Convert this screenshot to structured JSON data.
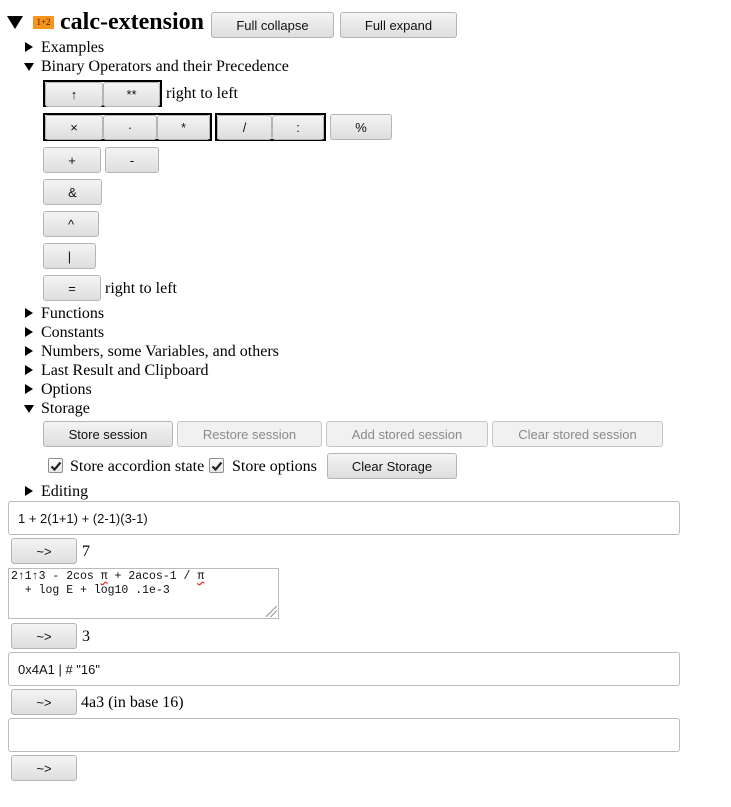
{
  "header": {
    "logo_text": "1+2",
    "title": "calc-extension",
    "full_collapse_label": "Full collapse",
    "full_expand_label": "Full expand",
    "accent_color": "#f7941d"
  },
  "sections": {
    "examples": {
      "label": "Examples",
      "expanded": false
    },
    "binary_operators": {
      "label": "Binary Operators and their Precedence",
      "expanded": true,
      "rows": {
        "power": {
          "ops": [
            "↑",
            "**"
          ],
          "note": "right to left"
        },
        "multiplicative": {
          "multiply_ops": [
            "×",
            "·",
            "*"
          ],
          "divide_ops": [
            "/",
            ":"
          ],
          "modulo": "%"
        },
        "additive": {
          "ops": [
            "+",
            "-"
          ]
        },
        "and": {
          "op": "&"
        },
        "xor": {
          "op": "^"
        },
        "or": {
          "op": "|"
        },
        "assign": {
          "op": "=",
          "note": "right to left"
        }
      }
    },
    "functions": {
      "label": "Functions",
      "expanded": false
    },
    "constants": {
      "label": "Constants",
      "expanded": false
    },
    "numbers": {
      "label": "Numbers, some Variables, and others",
      "expanded": false
    },
    "last_result": {
      "label": "Last Result and Clipboard",
      "expanded": false
    },
    "options": {
      "label": "Options",
      "expanded": false
    },
    "storage": {
      "label": "Storage",
      "expanded": true,
      "buttons": {
        "store_session": "Store session",
        "restore_session": "Restore session",
        "add_stored_session": "Add stored session",
        "clear_stored_session": "Clear stored session",
        "clear_storage": "Clear Storage"
      },
      "checkboxes": {
        "store_accordion_state": {
          "label": "Store accordion state",
          "checked": true
        },
        "store_options": {
          "label": "Store options",
          "checked": true
        }
      }
    },
    "editing": {
      "label": "Editing",
      "expanded": false
    }
  },
  "calculations": [
    {
      "input": "1 + 2(1+1) + (2-1)(3-1)",
      "button": "~>",
      "result": "7"
    },
    {
      "input_line1": "2↑1↑3 - 2cos π + 2acos-1 / π",
      "input_line2": "  + log E + log10 .1e-3",
      "button": "~>",
      "result": "3"
    },
    {
      "input": "0x4A1 | # \"16\"",
      "button": "~>",
      "result": "4a3 (in base 16)"
    },
    {
      "input": "",
      "button": "~>",
      "result": ""
    }
  ]
}
